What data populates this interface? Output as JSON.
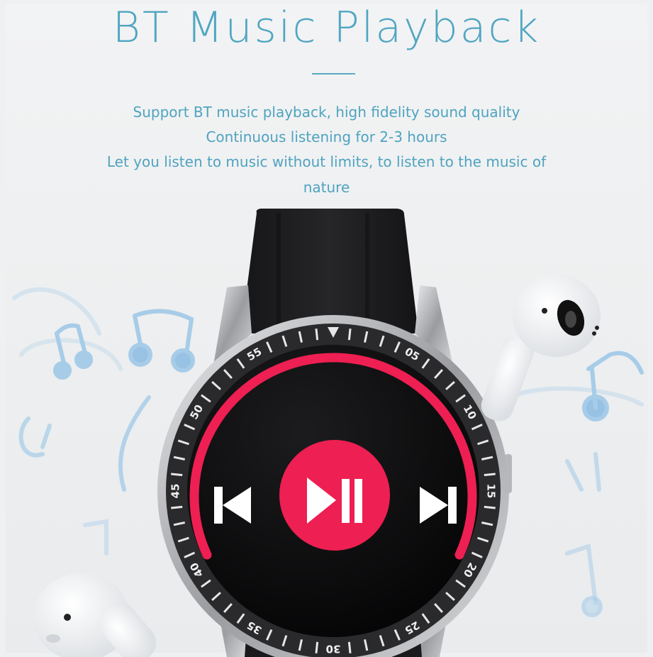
{
  "headline": "BT Music Playback",
  "description": {
    "line1": "Support BT music playback, high fidelity sound quality",
    "line2": "Continuous listening for 2-3 hours",
    "line3": "Let you listen to music without limits, to listen to the music of",
    "line4": "nature"
  },
  "watch": {
    "bezel_marks": [
      "05",
      "10",
      "15",
      "20",
      "25",
      "30",
      "35",
      "40",
      "45",
      "50",
      "55"
    ],
    "controls": [
      "previous-track",
      "play-pause",
      "next-track"
    ]
  },
  "colors": {
    "title": "#4fa6c2",
    "accent": "#ee1f52",
    "screen": "#0b0b0c",
    "strap": "#1e1e20",
    "bezel": "#2a2a2c"
  }
}
